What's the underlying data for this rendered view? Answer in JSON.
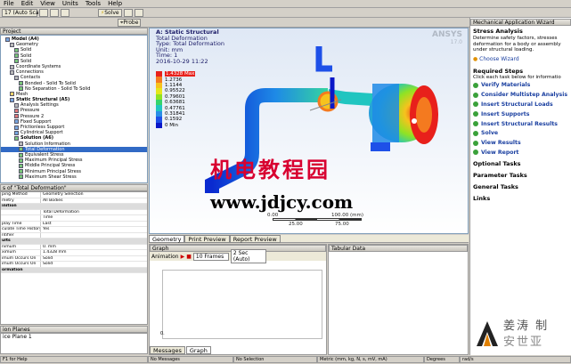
{
  "menu": [
    "File",
    "Edit",
    "View",
    "Units",
    "Tools",
    "Help"
  ],
  "toolbar": {
    "solve": "Solve",
    "probe": "Probe",
    "scale": "17 (Auto Scale)"
  },
  "project_label": "Project",
  "tree": [
    {
      "t": "Model (A4)",
      "i": "b",
      "d": 1,
      "b": true
    },
    {
      "t": "Geometry",
      "i": "gr",
      "d": 2
    },
    {
      "t": "Solid",
      "i": "g",
      "d": 3
    },
    {
      "t": "Solid",
      "i": "g",
      "d": 3
    },
    {
      "t": "Solid",
      "i": "g",
      "d": 3
    },
    {
      "t": "Coordinate Systems",
      "i": "gr",
      "d": 2
    },
    {
      "t": "Connections",
      "i": "gr",
      "d": 2
    },
    {
      "t": "Contacts",
      "i": "gr",
      "d": 3
    },
    {
      "t": "Bonded - Solid To Solid",
      "i": "g",
      "d": 4
    },
    {
      "t": "No Separation - Solid To Solid",
      "i": "g",
      "d": 4
    },
    {
      "t": "Mesh",
      "i": "y",
      "d": 2
    },
    {
      "t": "Static Structural (A5)",
      "i": "b",
      "d": 2,
      "b": true
    },
    {
      "t": "Analysis Settings",
      "i": "gr",
      "d": 3
    },
    {
      "t": "Pressure",
      "i": "r",
      "d": 3
    },
    {
      "t": "Pressure 2",
      "i": "r",
      "d": 3
    },
    {
      "t": "Fixed Support",
      "i": "b",
      "d": 3
    },
    {
      "t": "Frictionless Support",
      "i": "b",
      "d": 3
    },
    {
      "t": "Cylindrical Support",
      "i": "b",
      "d": 3
    },
    {
      "t": "Solution (A6)",
      "i": "g",
      "d": 3,
      "b": true
    },
    {
      "t": "Solution Information",
      "i": "gr",
      "d": 4
    },
    {
      "t": "Total Deformation",
      "i": "g",
      "d": 4,
      "sel": true
    },
    {
      "t": "Equivalent Stress",
      "i": "g",
      "d": 4
    },
    {
      "t": "Maximum Principal Stress",
      "i": "g",
      "d": 4
    },
    {
      "t": "Middle Principal Stress",
      "i": "g",
      "d": 4
    },
    {
      "t": "Minimum Principal Stress",
      "i": "g",
      "d": 4
    },
    {
      "t": "Maximum Shear Stress",
      "i": "g",
      "d": 4
    }
  ],
  "details_title": "s of \"Total Deformation\"",
  "details": [
    {
      "k": "ping Method",
      "v": "Geometry Selection"
    },
    {
      "k": "metry",
      "v": "All Bodies"
    },
    {
      "k": "inition",
      "v": "",
      "sec": true
    },
    {
      "k": "",
      "v": "Total Deformation"
    },
    {
      "k": "",
      "v": "Time"
    },
    {
      "k": "play Time",
      "v": "Last"
    },
    {
      "k": "culate Time History",
      "v": "Yes"
    },
    {
      "k": "ntifier",
      "v": ""
    },
    {
      "k": "ults",
      "v": "",
      "sec": true
    },
    {
      "k": "nimum",
      "v": "0. mm"
    },
    {
      "k": "ximum",
      "v": "1.4328 mm"
    },
    {
      "k": "imum Occurs On",
      "v": "Solid"
    },
    {
      "k": "imum Occurs On",
      "v": "Solid"
    },
    {
      "k": "ormation",
      "v": "",
      "sec": true
    }
  ],
  "section_planes": {
    "title": "ion Planes",
    "value": "ice Plane 1"
  },
  "viewport": {
    "line1": "A: Static Structural",
    "line2": "Total Deformation",
    "line3": "Type: Total Deformation",
    "line4": "Unit: mm",
    "line5": "Time: 1",
    "line6": "2016-10-29 11:22",
    "brand": "ANSYS",
    "version": "17.0",
    "legend": [
      {
        "v": "1.4328 Max",
        "c": "#e8201b"
      },
      {
        "v": "1.2736",
        "c": "#f47a1f"
      },
      {
        "v": "1.1144",
        "c": "#f7c21d"
      },
      {
        "v": "0.95522",
        "c": "#e5e61c"
      },
      {
        "v": "0.79601",
        "c": "#8fe324"
      },
      {
        "v": "0.63681",
        "c": "#35d46b"
      },
      {
        "v": "0.47761",
        "c": "#20c5c0"
      },
      {
        "v": "0.31841",
        "c": "#2a8ee6"
      },
      {
        "v": "0.1592",
        "c": "#1e50e8"
      },
      {
        "v": "0 Min",
        "c": "#0a17c8"
      }
    ],
    "scale_lo": "0.00",
    "scale_hi": "100.00 (mm)",
    "scale_q1": "25.00",
    "scale_q3": "75.00"
  },
  "watermark1": "机电教程园",
  "watermark2": "www.jdjcy.com",
  "view_tabs": [
    "Geometry",
    "Print Preview",
    "Report Preview"
  ],
  "graph": {
    "title": "Graph",
    "animation": "Animation",
    "frames": "10 Frames",
    "time": "2 Sec (Auto)",
    "axis_zero": "0."
  },
  "tabular": {
    "title": "Tabular Data"
  },
  "bottom_tabs": [
    "Messages",
    "Graph"
  ],
  "wizard": {
    "title": "Mechanical Application Wizard",
    "heading": "Stress Analysis",
    "desc": "Determine safety factors, stresses deformation for a body or assembly under structural loading.",
    "choose": "Choose Wizard",
    "req": "Required Steps",
    "click": "Click each task below for informatio",
    "steps": [
      "Verify Materials",
      "Consider Multistep Analysis",
      "Insert Structural Loads",
      "Insert Supports",
      "Insert Structural Results",
      "Solve",
      "View Results",
      "View Report"
    ],
    "optional": "Optional Tasks",
    "param": "Parameter Tasks",
    "general": "General Tasks",
    "links": "Links"
  },
  "status": [
    "F1 for Help",
    "No Messages",
    "No Selection",
    "Metric (mm, kg, N, s, mV, mA)",
    "Degrees",
    "rad/s"
  ],
  "logo_text": "姜涛 制",
  "logo_sub": "安世亚"
}
